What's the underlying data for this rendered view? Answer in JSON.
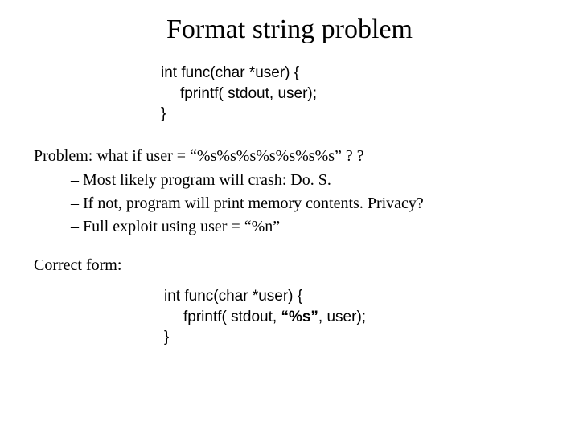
{
  "title": "Format string problem",
  "code1": {
    "l1": "int  func(char *user)  {",
    "l2": "fprintf( stdout, user);",
    "l3": "}"
  },
  "problem": {
    "label": "Problem:   what if   user = ",
    "fmt": "“%s%s%s%s%s%s%s”",
    "tail": "  ? ?"
  },
  "bullets": {
    "b1": "Most likely program will crash:   Do. S.",
    "b2": "If not, program will print memory contents.  Privacy?",
    "b3_pre": "Full exploit using   user = ",
    "b3_fmt": "“%n”"
  },
  "correct": "Correct form:",
  "code2": {
    "l1": "int  func(char *user)  {",
    "l2_pre": "fprintf( stdout, ",
    "l2_fmt": "“%s”",
    "l2_post": ", user);",
    "l3": "}"
  }
}
